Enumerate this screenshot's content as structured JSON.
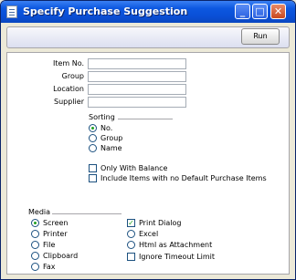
{
  "window": {
    "title": "Specify Purchase Suggestion"
  },
  "toolbar": {
    "run_label": "Run"
  },
  "fields": [
    {
      "label": "Item No.",
      "value": ""
    },
    {
      "label": "Group",
      "value": ""
    },
    {
      "label": "Location",
      "value": ""
    },
    {
      "label": "Supplier",
      "value": ""
    }
  ],
  "sorting": {
    "title": "Sorting",
    "options": [
      {
        "label": "No.",
        "selected": true
      },
      {
        "label": "Group",
        "selected": false
      },
      {
        "label": "Name",
        "selected": false
      }
    ]
  },
  "options": [
    {
      "label": "Only With Balance",
      "checked": false
    },
    {
      "label": "Include Items with no Default Purchase Items",
      "checked": false
    }
  ],
  "media": {
    "title": "Media",
    "options": [
      {
        "label": "Screen",
        "selected": true
      },
      {
        "label": "Printer",
        "selected": false
      },
      {
        "label": "File",
        "selected": false
      },
      {
        "label": "Clipboard",
        "selected": false
      },
      {
        "label": "Fax",
        "selected": false
      }
    ]
  },
  "output_options": {
    "print_dialog": {
      "label": "Print Dialog",
      "checked": true
    },
    "format": [
      {
        "label": "Excel",
        "selected": false
      },
      {
        "label": "Html as Attachment",
        "selected": false
      }
    ],
    "ignore_timeout": {
      "label": "Ignore Timeout Limit",
      "checked": false
    }
  }
}
